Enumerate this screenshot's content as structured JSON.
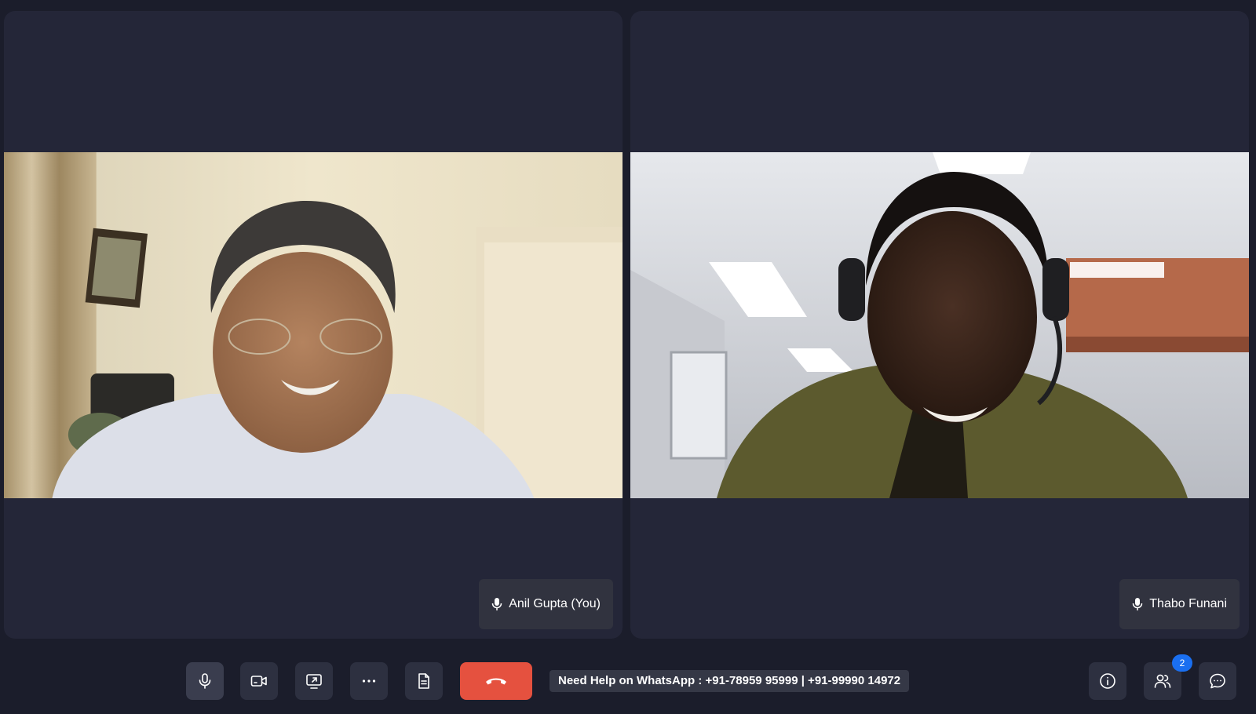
{
  "participants": [
    {
      "name": "Anil Gupta (You)",
      "mic": "microphone-icon"
    },
    {
      "name": "Thabo Funani",
      "mic": "microphone-icon"
    }
  ],
  "toolbar": {
    "help_text": "Need Help on WhatsApp : +91-78959 95999 | +91-99990 14972",
    "participants_count": "2"
  },
  "colors": {
    "background": "#1b1d2b",
    "tile": "#242638",
    "end_call": "#e5513f",
    "badge": "#1a6ff0"
  }
}
